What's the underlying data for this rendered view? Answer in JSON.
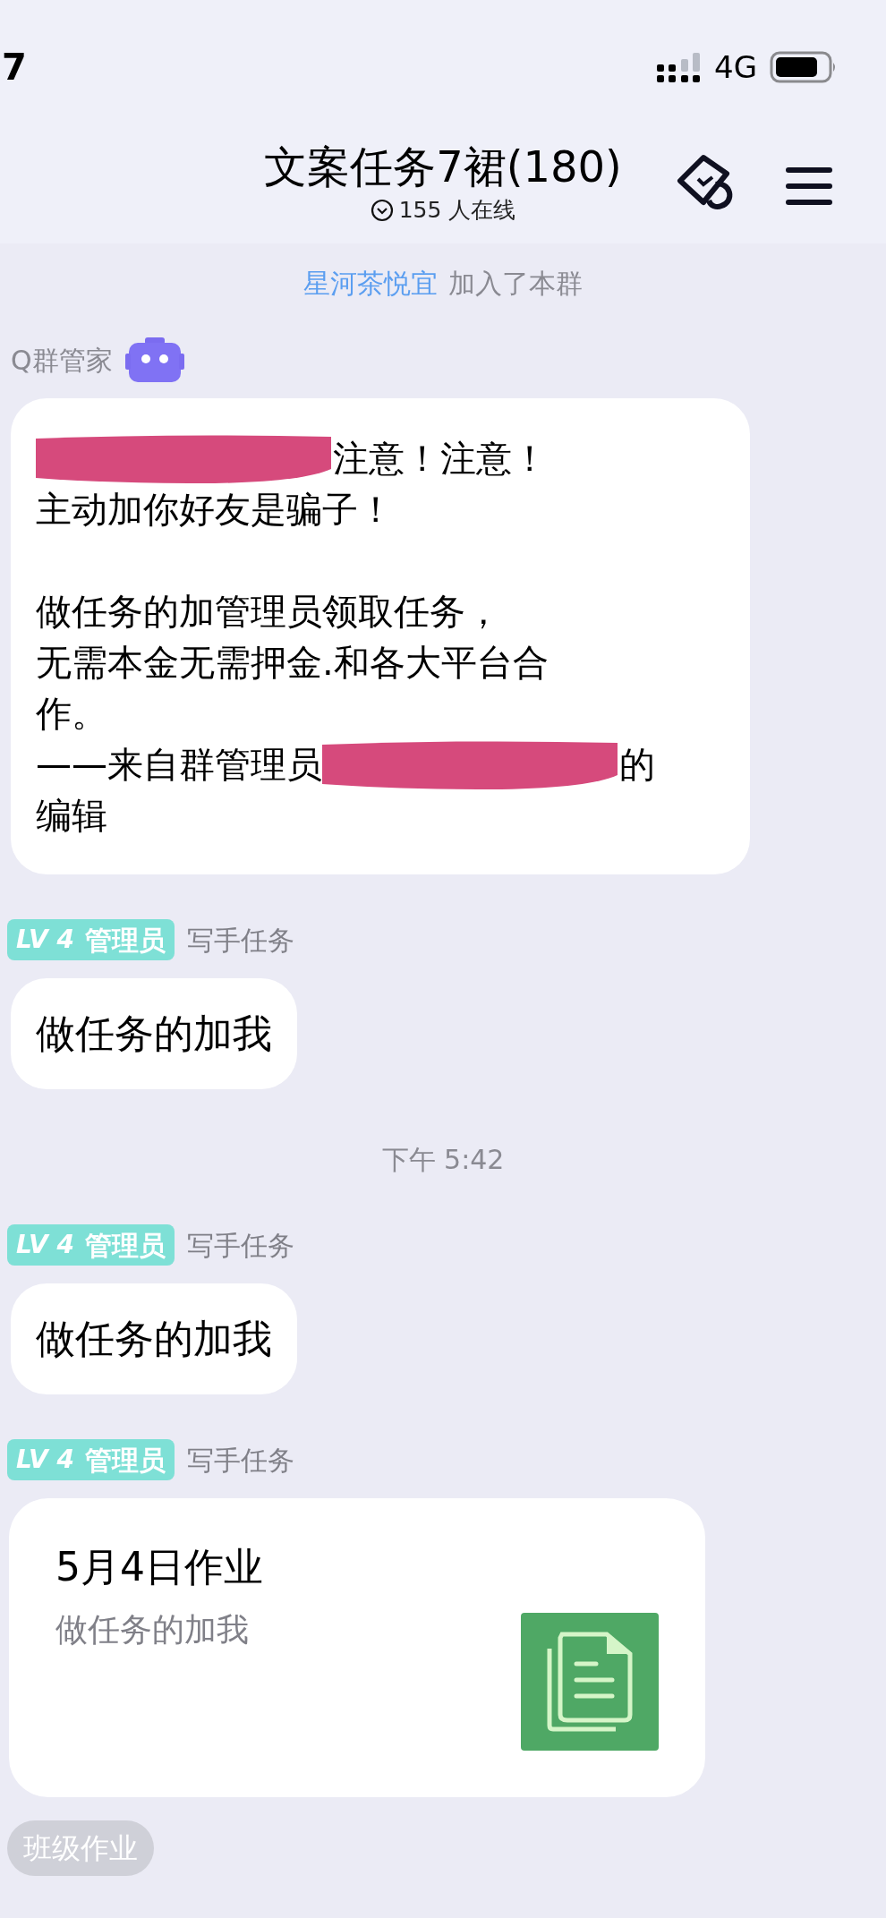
{
  "status_bar": {
    "time": "7",
    "network": "4G"
  },
  "header": {
    "title": "文案任务7裙(180)",
    "online": "155 人在线"
  },
  "messages": [
    {
      "kind": "system",
      "name": "星河茶悦宜",
      "text": "加入了本群"
    },
    {
      "kind": "bot",
      "sender": "Q群管家",
      "paragraphs": [
        [
          [
            {
              "kind": "redacted"
            },
            {
              "kind": "text",
              "text": "注意！注意！"
            }
          ],
          [
            {
              "kind": "text",
              "text": "主动加你好友是骗子！"
            }
          ]
        ],
        [
          [
            {
              "kind": "text",
              "text": "做任务的加管理员领取任务，"
            }
          ],
          [
            {
              "kind": "text",
              "text": "无需本金无需押金.和各大平台合"
            }
          ],
          [
            {
              "kind": "text",
              "text": "作。"
            }
          ],
          [
            {
              "kind": "text",
              "text": "——来自群管理员"
            },
            {
              "kind": "redacted"
            },
            {
              "kind": "text",
              "text": "的"
            }
          ],
          [
            {
              "kind": "text",
              "text": "编辑"
            }
          ]
        ]
      ]
    },
    {
      "kind": "member",
      "level": "LV 4",
      "role": "管理员",
      "sender": "写手任务",
      "text": "做任务的加我"
    },
    {
      "kind": "time",
      "text": "下午 5:42"
    },
    {
      "kind": "member",
      "level": "LV 4",
      "role": "管理员",
      "sender": "写手任务",
      "text": "做任务的加我"
    },
    {
      "kind": "file",
      "level": "LV 4",
      "role": "管理员",
      "sender": "写手任务",
      "title": "5月4日作业",
      "subtitle": "做任务的加我"
    }
  ],
  "tag_chip": "班级作业"
}
